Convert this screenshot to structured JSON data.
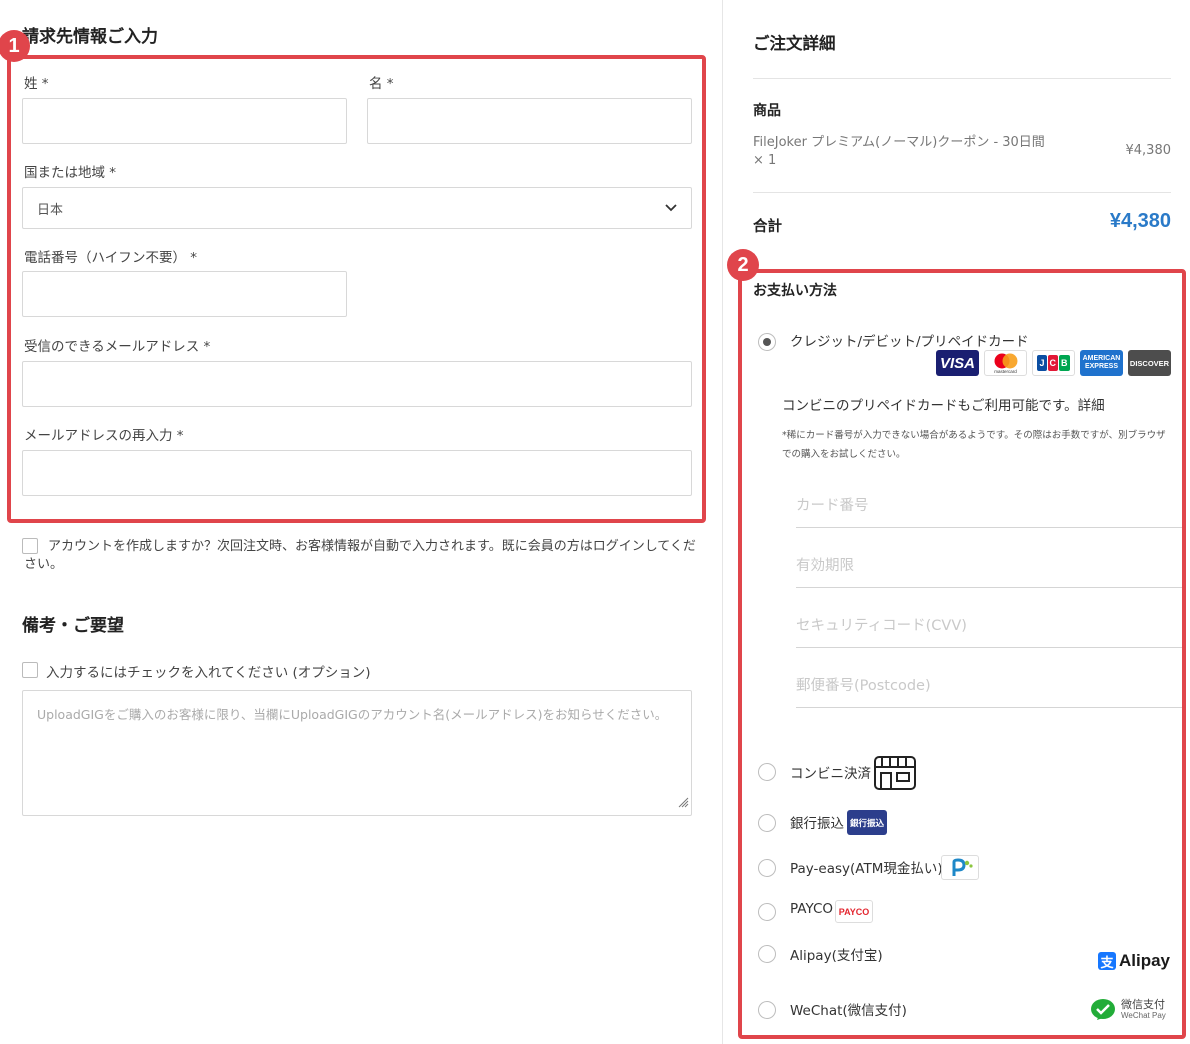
{
  "billing": {
    "title": "請求先情報ご入力",
    "last_name_label": "姓 *",
    "first_name_label": "名 *",
    "country_label": "国または地域 *",
    "country_value": "日本",
    "phone_label": "電話番号（ハイフン不要） *",
    "email_label": "受信のできるメールアドレス *",
    "email_confirm_label": "メールアドレスの再入力 *"
  },
  "account": {
    "create_text": "アカウントを作成しますか？次回注文時、お客様情報が自動で入力されます。既に会員の方はログインしてください。"
  },
  "notes": {
    "title": "備考・ご要望",
    "check_label": "入力するにはチェックを入れてください (オプション)",
    "placeholder": "UploadGIGをご購入のお客様に限り、当欄にUploadGIGのアカウント名(メールアドレス)をお知らせください。"
  },
  "order": {
    "title": "ご注文詳細",
    "product_header": "商品",
    "product_name": "FileJoker プレミアム(ノーマル)クーポン - 30日間",
    "product_qty": "× 1",
    "product_price": "¥4,380",
    "total_label": "合計",
    "total_value": "¥4,380"
  },
  "payment": {
    "title": "お支払い方法",
    "card_label": "クレジット/デビット/プリペイドカード",
    "card_logos": [
      "VISA",
      "mastercard",
      "JCB",
      "AMERICAN EXPRESS",
      "DISCOVER"
    ],
    "prepaid_note": "コンビニのプリペイドカードもご利用可能です。詳細",
    "small_note": "*稀にカード番号が入力できない場合があるようです。その際はお手数ですが、別ブラウザでの購入をお試しください。",
    "card_number_ph": "カード番号",
    "expiry_ph": "有効期限",
    "cvv_ph": "セキュリティコード(CVV)",
    "postcode_ph": "郵便番号(Postcode)",
    "methods": {
      "konbini": "コンビニ決済",
      "bank": "銀行振込",
      "bank_logo": "銀行振込",
      "payeasy": "Pay-easy(ATM現金払い)",
      "payco": "PAYCO",
      "payco_logo": "PAYCO",
      "alipay": "Alipay(支付宝)",
      "alipay_logo": "Alipay",
      "wechat": "WeChat(微信支付)",
      "wechat_logo_cn": "微信支付",
      "wechat_logo_en": "WeChat Pay"
    }
  },
  "annotations": {
    "one": "1",
    "two": "2"
  },
  "colors": {
    "highlight": "#e0454b",
    "total": "#2a7ac8"
  }
}
